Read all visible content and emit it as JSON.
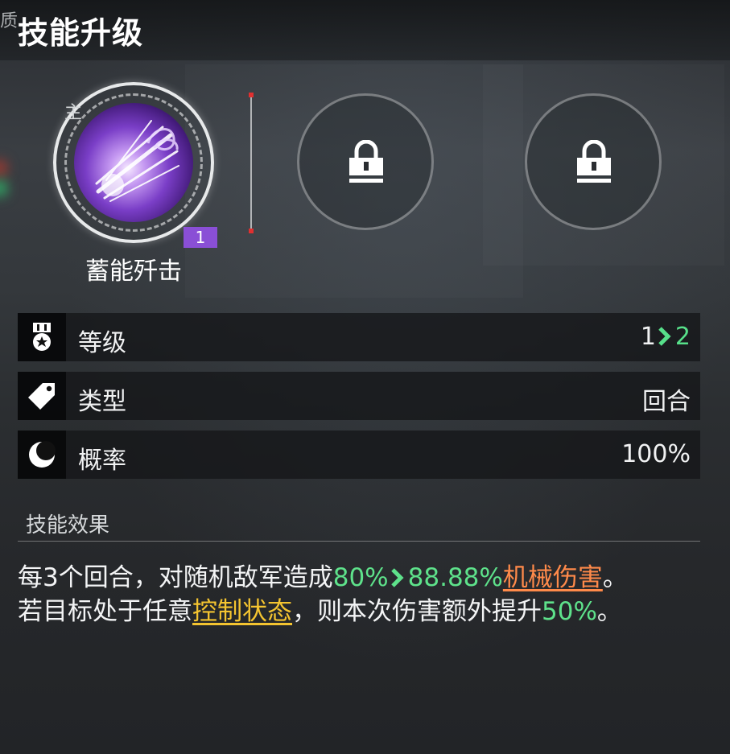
{
  "header": {
    "prefix": "质",
    "title": "技能升级"
  },
  "skill": {
    "main_tag": "主",
    "name": "蓄能歼击",
    "level_badge": "1",
    "locked_slots": [
      {
        "icon": "lock-icon"
      },
      {
        "icon": "lock-icon"
      }
    ]
  },
  "stats": [
    {
      "icon": "medal-icon",
      "label": "等级",
      "value_from": "1",
      "value_to": "2"
    },
    {
      "icon": "tag-icon",
      "label": "类型",
      "value": "回合"
    },
    {
      "icon": "moon-icon",
      "label": "概率",
      "value": "100%"
    }
  ],
  "effect": {
    "title": "技能效果",
    "line1": {
      "prefix": "每3个回合，对随机敌军造成",
      "value_from": "80%",
      "value_to": "88.88%",
      "keyword": "机械伤害",
      "suffix": "。"
    },
    "line2": {
      "prefix": "若目标处于任意",
      "keyword": "控制状态",
      "middle": "，则本次伤害额外提升",
      "value": "50%",
      "suffix": "。"
    }
  },
  "colors": {
    "accent_green": "#5ee28b",
    "keyword_orange": "#ff8a4a",
    "keyword_yellow": "#f4c430",
    "badge_purple": "#8a4fd6"
  }
}
